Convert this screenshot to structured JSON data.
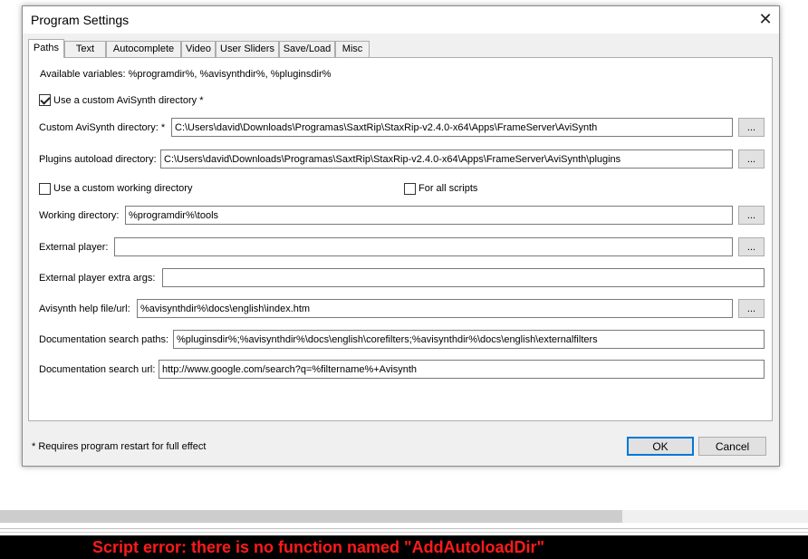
{
  "dialog": {
    "title": "Program Settings",
    "close_glyph": "✕"
  },
  "tabs": [
    {
      "label": "Paths",
      "active": true
    },
    {
      "label": "Text"
    },
    {
      "label": "Autocomplete"
    },
    {
      "label": "Video"
    },
    {
      "label": "User Sliders"
    },
    {
      "label": "Save/Load"
    },
    {
      "label": "Misc"
    }
  ],
  "paths": {
    "available_variables": "Available variables: %programdir%, %avisynthdir%, %pluginsdir%",
    "use_custom_avisynth": {
      "label": "Use a custom AviSynth directory *",
      "checked": true
    },
    "custom_avisynth_dir": {
      "label": "Custom AviSynth directory: *",
      "value": "C:\\Users\\david\\Downloads\\Programas\\SaxtRip\\StaxRip-v2.4.0-x64\\Apps\\FrameServer\\AviSynth"
    },
    "plugins_autoload_dir": {
      "label": "Plugins autoload directory:",
      "value": "C:\\Users\\david\\Downloads\\Programas\\SaxtRip\\StaxRip-v2.4.0-x64\\Apps\\FrameServer\\AviSynth\\plugins"
    },
    "use_custom_working": {
      "label": "Use a custom working directory",
      "checked": false
    },
    "for_all_scripts": {
      "label": "For all scripts",
      "checked": false
    },
    "working_dir": {
      "label": "Working directory:",
      "value": "%programdir%\\tools"
    },
    "external_player": {
      "label": "External player:",
      "value": ""
    },
    "external_player_args": {
      "label": "External player extra args:",
      "value": ""
    },
    "avisynth_help": {
      "label": "Avisynth help file/url:",
      "value": "%avisynthdir%\\docs\\english\\index.htm"
    },
    "doc_search_paths": {
      "label": "Documentation search paths:",
      "value": "%pluginsdir%;%avisynthdir%\\docs\\english\\corefilters;%avisynthdir%\\docs\\english\\externalfilters"
    },
    "doc_search_url": {
      "label": "Documentation search url:",
      "value": "http://www.google.com/search?q=%filtername%+Avisynth"
    },
    "browse_label": "..."
  },
  "footer": {
    "note": "* Requires program restart for full effect",
    "ok_label": "OK",
    "cancel_label": "Cancel"
  },
  "scrollbar": {
    "thumb_fraction": 0.77
  },
  "error_bar": {
    "message": "Script error: there is no function named \"AddAutoloadDir\"",
    "color": "#ff1a1a"
  }
}
